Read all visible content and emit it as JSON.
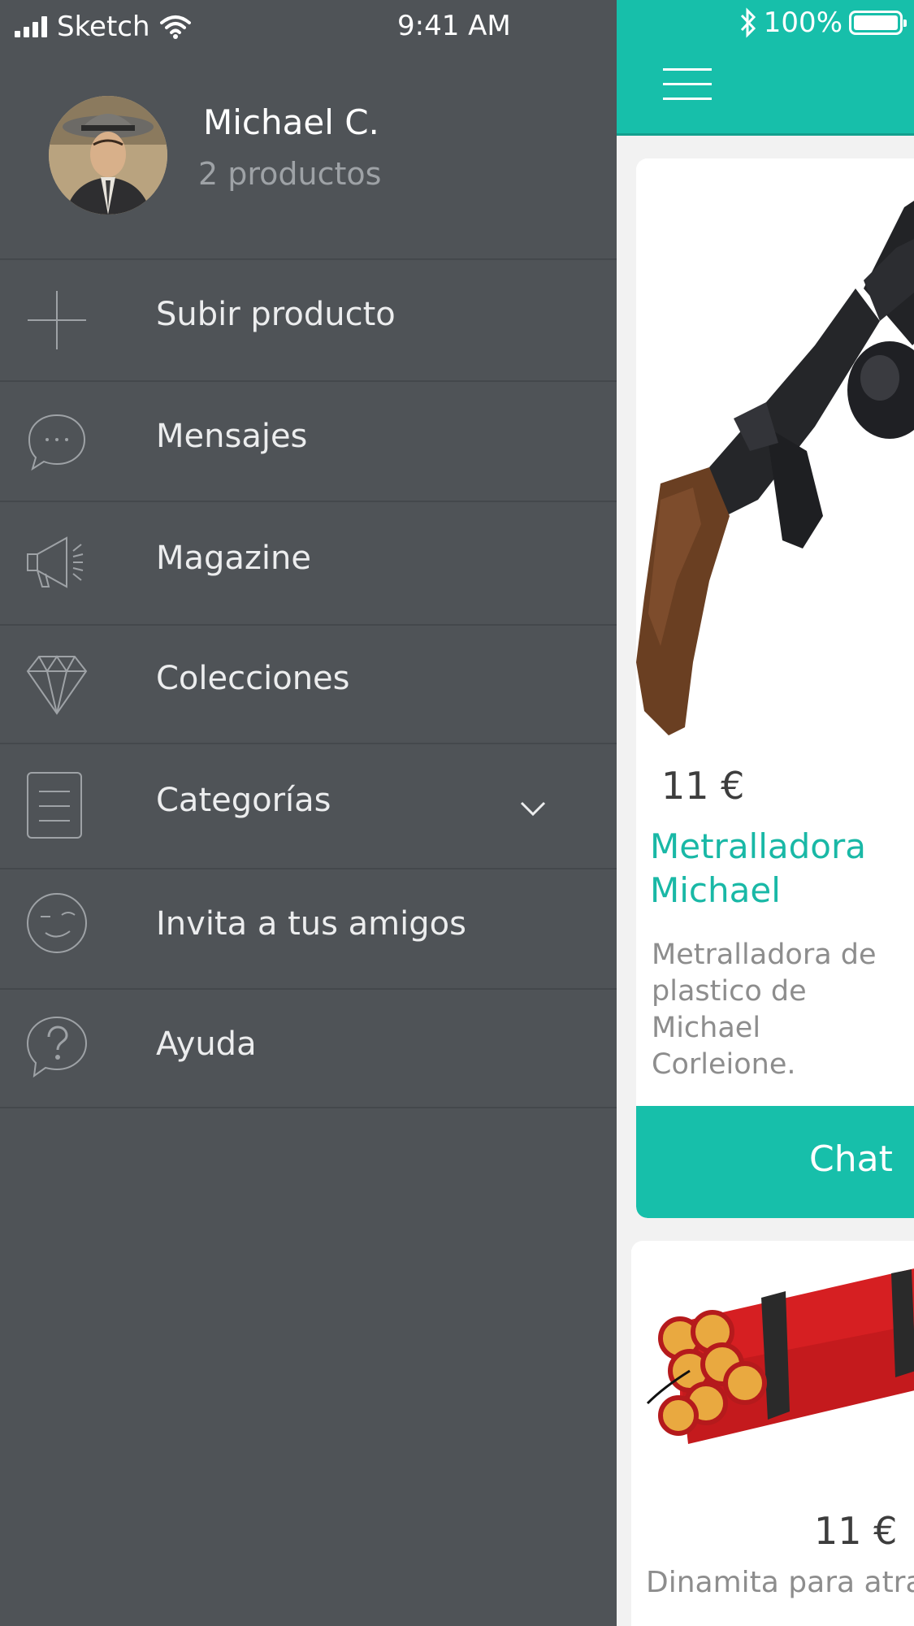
{
  "status_bar": {
    "carrier": "Sketch",
    "time": "9:41 AM",
    "battery": "100%"
  },
  "profile": {
    "name": "Michael C.",
    "products": "2 productos"
  },
  "menu": {
    "items": [
      {
        "label": "Subir producto",
        "icon": "plus-icon"
      },
      {
        "label": "Mensajes",
        "icon": "chat-bubble-icon"
      },
      {
        "label": "Magazine",
        "icon": "megaphone-icon"
      },
      {
        "label": "Colecciones",
        "icon": "diamond-icon"
      },
      {
        "label": "Categorías",
        "icon": "list-icon"
      },
      {
        "label": "Invita a tus amigos",
        "icon": "wink-face-icon"
      },
      {
        "label": "Ayuda",
        "icon": "help-bubble-icon"
      }
    ]
  },
  "products": [
    {
      "price": "11 €",
      "title": "Metralladora Michael",
      "description": "Metralladora de plastico de Michael Corleione.",
      "action": "Chat"
    },
    {
      "price": "11 €",
      "title": "Dinamita para atra"
    }
  ],
  "colors": {
    "drawer_bg": "#4f5357",
    "accent": "#17bfaa",
    "muted_text": "#9ea2a6"
  }
}
